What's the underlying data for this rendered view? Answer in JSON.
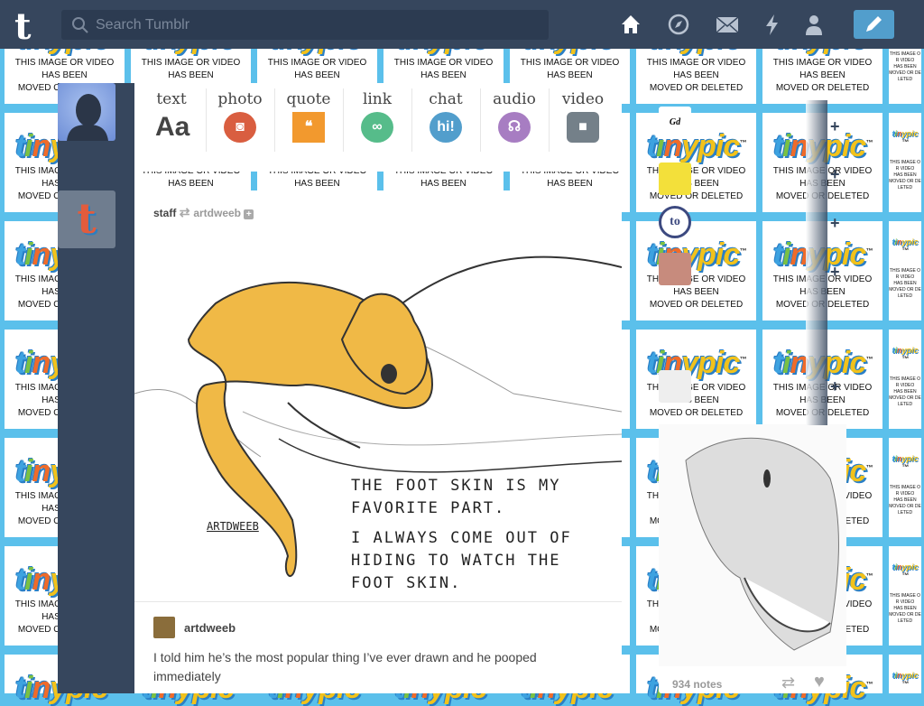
{
  "header": {
    "logo": "t",
    "search_placeholder": "Search Tumblr",
    "nav": [
      "home-icon",
      "explore-icon",
      "inbox-icon",
      "activity-icon",
      "account-icon"
    ],
    "compose": "pencil-icon"
  },
  "background": {
    "logo_parts": [
      "t",
      "i",
      "n",
      "ypic"
    ],
    "tm": "™",
    "msg_line1": "THIS IMAGE OR VIDEO",
    "msg_line2": "HAS BEEN",
    "msg_line3": "MOVED OR DELETED"
  },
  "composer": {
    "types": [
      {
        "label": "text",
        "glyph": "Aa",
        "color": "#444444"
      },
      {
        "label": "photo",
        "glyph": "◙",
        "color": "#d95e40"
      },
      {
        "label": "quote",
        "glyph": "❝",
        "color": "#f2992e"
      },
      {
        "label": "link",
        "glyph": "∞",
        "color": "#56bc8a"
      },
      {
        "label": "chat",
        "glyph": "hi!",
        "color": "#529ecc"
      },
      {
        "label": "audio",
        "glyph": "☊",
        "color": "#a77dc2"
      },
      {
        "label": "video",
        "glyph": "■",
        "color": "#748089"
      }
    ]
  },
  "post": {
    "author": "staff",
    "reblogged_from": "artdweeb",
    "caption_lines": [
      "THE FOOT SKIN IS MY",
      "FAVORITE PART.",
      "I ALWAYS COME OUT OF",
      "HIDING TO WATCH THE",
      "FOOT SKIN."
    ],
    "signature": "ARTDWEEB",
    "comment_author": "artdweeb",
    "comment": "I told him he’s the most popular thing I’ve ever drawn and he pooped immediately"
  },
  "side_post": {
    "notes": "934 notes"
  },
  "colors": {
    "navy": "#36465d",
    "accent": "#529ecc",
    "bg": "#5bc0eb"
  }
}
